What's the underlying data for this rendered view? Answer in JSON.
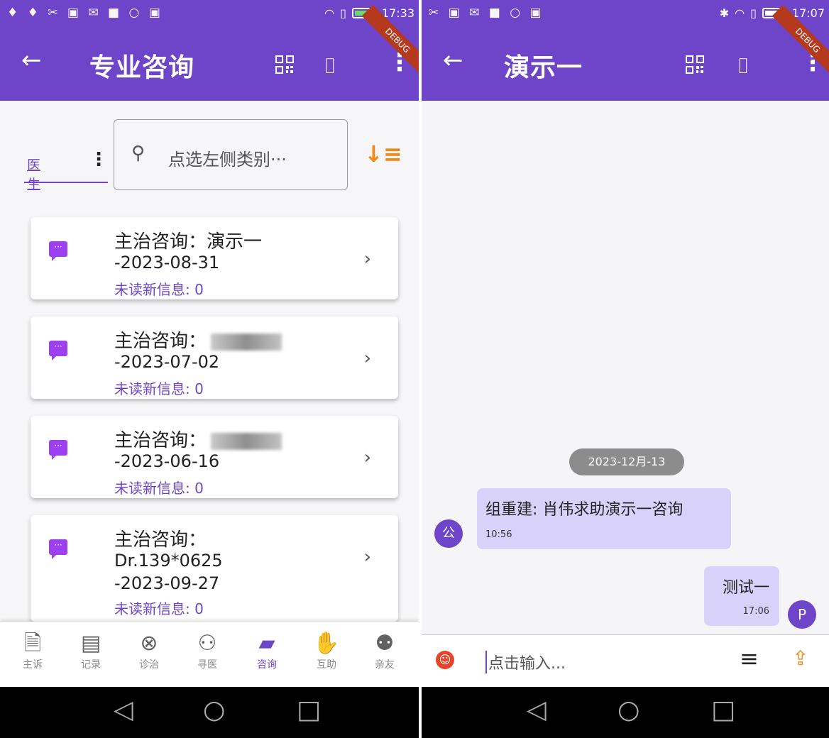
{
  "left": {
    "status": {
      "icons": "♦ ♦ ✂ ▣ ✉ ■ ○ ▣",
      "time": "17:33"
    },
    "appbar": {
      "title": "专业咨询",
      "ribbon": "DEBUG"
    },
    "tab": {
      "label": "医生"
    },
    "search": {
      "placeholder": "点选左侧类别···"
    },
    "cards": [
      {
        "line1": "主治咨询：演示一",
        "line2": "-2023-08-31",
        "line3": "未读新信息: 0"
      },
      {
        "line1": "主治咨询：",
        "line2": "-2023-07-02",
        "line3": "未读新信息: 0"
      },
      {
        "line1": "主治咨询：",
        "line2": "-2023-06-16",
        "line3": "未读新信息: 0"
      },
      {
        "line1": "主治咨询：",
        "line2": "Dr.139*0625",
        "line3": "-2023-09-27",
        "line4": "未读新信息: 0"
      }
    ],
    "nav": [
      {
        "label": "主诉",
        "icon": "clipboard-icon"
      },
      {
        "label": "记录",
        "icon": "records-icon"
      },
      {
        "label": "诊治",
        "icon": "pill-icon"
      },
      {
        "label": "寻医",
        "icon": "find-doctor-icon"
      },
      {
        "label": "咨询",
        "icon": "chat-icon"
      },
      {
        "label": "互助",
        "icon": "handshake-icon"
      },
      {
        "label": "亲友",
        "icon": "family-icon"
      }
    ]
  },
  "right": {
    "status": {
      "icons": "✂ ▣ ✉ ■ ○ ▣",
      "time": "17:07"
    },
    "appbar": {
      "title": "演示一",
      "ribbon": "DEBUG"
    },
    "date_pill": "2023-12月-13",
    "incoming": {
      "avatar": "公",
      "text": "组重建: 肖伟求助演示一咨询",
      "time": "10:56"
    },
    "outgoing": {
      "avatar": "P",
      "text": "测试一",
      "time": "17:06"
    },
    "input": {
      "placeholder": "点击输入..."
    }
  },
  "colors": {
    "primary": "#6e45c9",
    "accent": "#ef8a1b",
    "bubble": "#d8d2fb",
    "card_icon": "#9c40f0"
  }
}
